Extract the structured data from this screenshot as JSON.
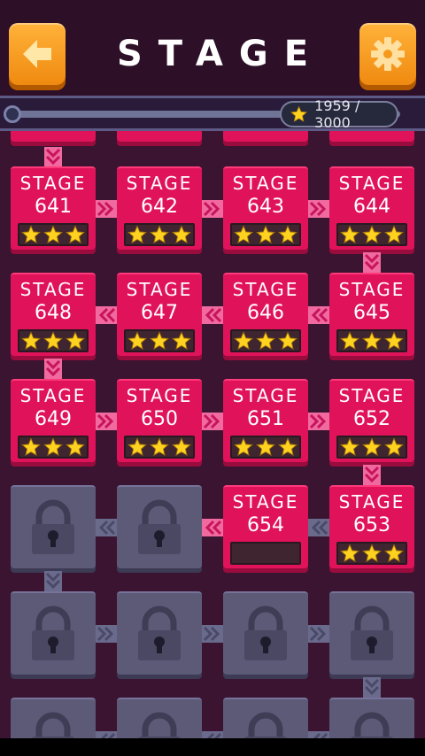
{
  "header": {
    "title": "STAGE",
    "back_icon": "arrow-left-icon",
    "settings_icon": "gear-icon",
    "accent_color": "#f59a1c"
  },
  "progress": {
    "stars_text": "1959 / 3000",
    "stars_collected": 1959,
    "stars_total": 3000
  },
  "stage_label": "STAGE",
  "rows": [
    {
      "direction": "right",
      "stages": [
        {
          "number": "641",
          "stars": 3
        },
        {
          "number": "642",
          "stars": 3
        },
        {
          "number": "643",
          "stars": 3
        },
        {
          "number": "644",
          "stars": 3
        }
      ]
    },
    {
      "direction": "left",
      "stages": [
        {
          "number": "648",
          "stars": 3
        },
        {
          "number": "647",
          "stars": 3
        },
        {
          "number": "646",
          "stars": 3
        },
        {
          "number": "645",
          "stars": 3
        }
      ]
    },
    {
      "direction": "right",
      "stages": [
        {
          "number": "649",
          "stars": 3
        },
        {
          "number": "650",
          "stars": 3
        },
        {
          "number": "651",
          "stars": 3
        },
        {
          "number": "652",
          "stars": 3
        }
      ]
    },
    {
      "direction": "left",
      "stages": [
        {
          "number": "",
          "locked": true
        },
        {
          "number": "",
          "locked": true
        },
        {
          "number": "654",
          "stars": 0
        },
        {
          "number": "653",
          "stars": 3
        }
      ]
    },
    {
      "direction": "right",
      "stages": [
        {
          "number": "",
          "locked": true
        },
        {
          "number": "",
          "locked": true
        },
        {
          "number": "",
          "locked": true
        },
        {
          "number": "",
          "locked": true
        }
      ]
    },
    {
      "direction": "left",
      "stages": [
        {
          "number": "",
          "locked": true
        },
        {
          "number": "",
          "locked": true
        },
        {
          "number": "",
          "locked": true
        },
        {
          "number": "",
          "locked": true
        }
      ]
    }
  ],
  "colors": {
    "open_tile": "#e0135a",
    "locked_tile": "#5d5a78",
    "star": "#ffd21f",
    "background": "#3a1430"
  }
}
